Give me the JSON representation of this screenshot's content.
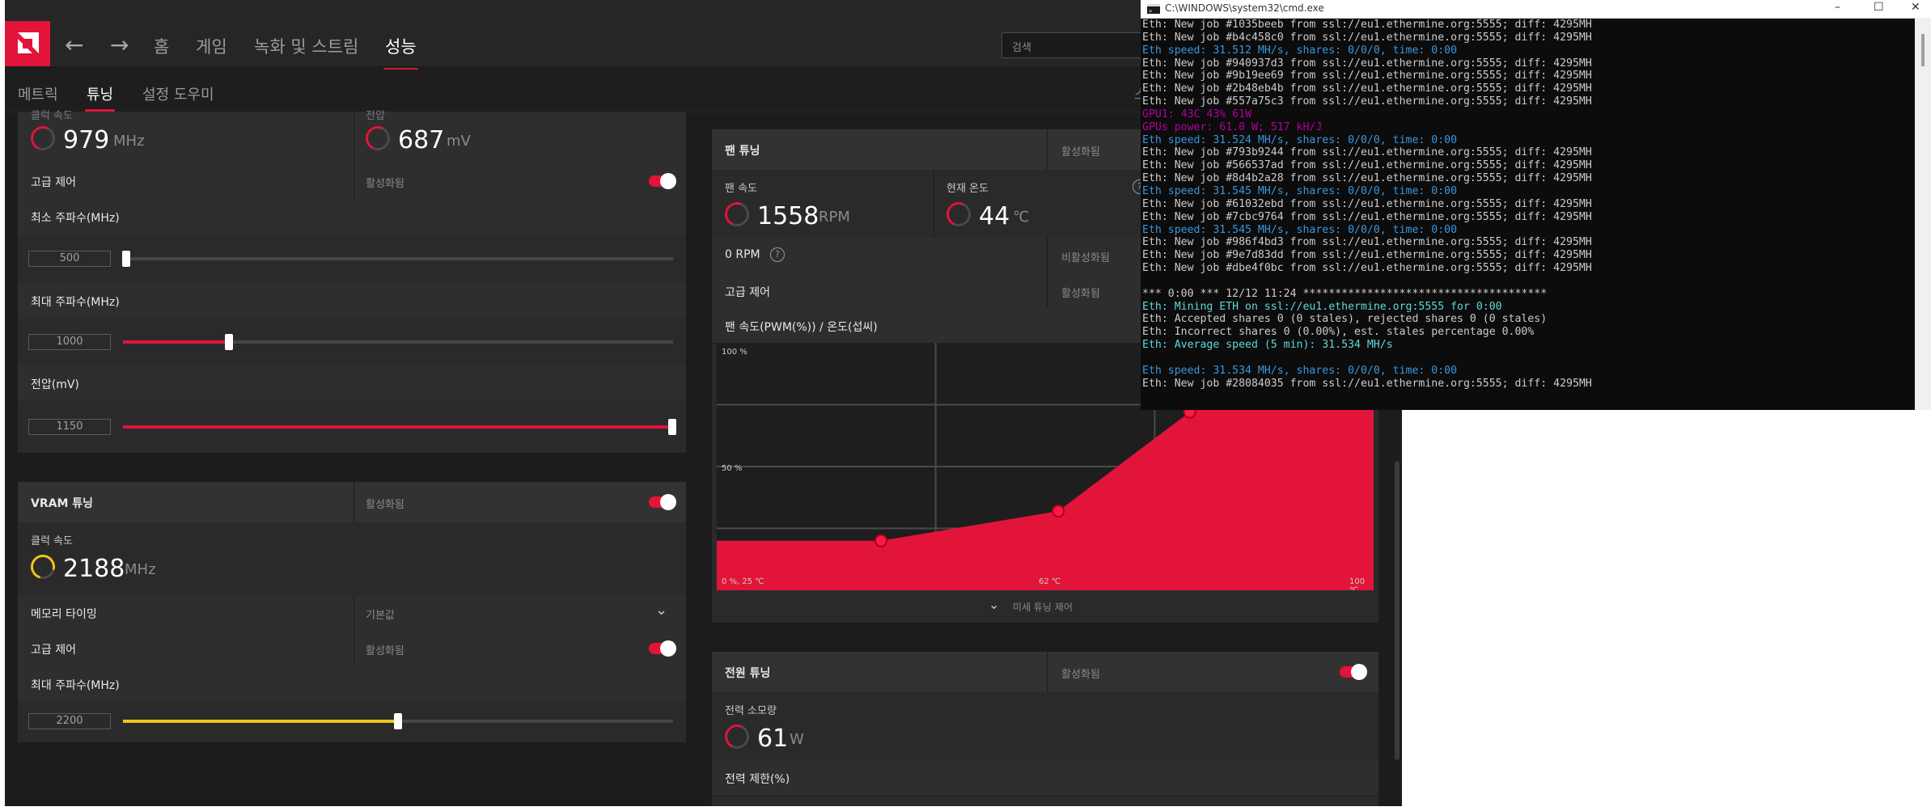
{
  "header": {
    "nav": [
      "홈",
      "게임",
      "녹화 및 스트림",
      "성능"
    ],
    "active_nav": "성능",
    "search_placeholder": "검색"
  },
  "subnav": {
    "items": [
      "메트릭",
      "튜닝",
      "설정 도우미"
    ],
    "active": "튜닝",
    "cut_text": "스"
  },
  "gpu_tuning": {
    "clock_label_cut": "클럭 속도",
    "voltage_label_cut": "전압",
    "clock_value": "979",
    "clock_unit": "MHz",
    "voltage_value": "687",
    "voltage_unit": "mV",
    "advanced_label": "고급 제어",
    "advanced_status": "활성화됨",
    "min_freq_label": "최소 주파수(MHz)",
    "min_freq_value": "500",
    "max_freq_label": "최대 주파수(MHz)",
    "max_freq_value": "1000",
    "voltage_mv_label": "전압(mV)",
    "voltage_mv_value": "1150"
  },
  "vram_tuning": {
    "title": "VRAM 튜닝",
    "status": "활성화됨",
    "clock_label": "클럭 속도",
    "clock_value": "2188",
    "clock_unit": "MHz",
    "memory_timing_label": "메모리 타이밍",
    "memory_timing_value": "기본값",
    "advanced_label": "고급 제어",
    "advanced_status": "활성화됨",
    "max_freq_label": "최대 주파수(MHz)",
    "max_freq_value": "2200"
  },
  "fan_tuning": {
    "title": "팬 튜닝",
    "status": "활성화됨",
    "fan_speed_label": "팬 속도",
    "fan_speed_value": "1558",
    "fan_speed_unit": "RPM",
    "temp_label": "현재 온도",
    "temp_value": "44",
    "temp_unit": "℃",
    "zero_rpm_label": "0 RPM",
    "zero_rpm_status": "비활성화됨",
    "advanced_label": "고급 제어",
    "advanced_status": "활성화됨",
    "curve_label": "팬 속도(PWM(%)) / 온도(섭씨)",
    "fine_tune_label": "미세 튜닝 제어"
  },
  "chart_data": {
    "type": "area",
    "xlabel": "",
    "ylabel": "",
    "y_tick_labels": [
      "100 %",
      "50 %"
    ],
    "x_tick_labels": [
      "0 %, 25 ℃",
      "62 ℃",
      "100 ℃"
    ],
    "points": [
      [
        25,
        20
      ],
      [
        52,
        32
      ],
      [
        72,
        72
      ],
      [
        83,
        100
      ],
      [
        100,
        100
      ]
    ],
    "xlim": [
      0,
      100
    ],
    "ylim": [
      0,
      100
    ],
    "fill_color": "#e2143a"
  },
  "power_tuning": {
    "title": "전원 튜닝",
    "status": "활성화됨",
    "consumption_label": "전력 소모량",
    "consumption_value": "61",
    "consumption_unit": "W",
    "limit_label": "전력 제한(%)"
  },
  "cmd": {
    "title": "C:\\WINDOWS\\system32\\cmd.exe",
    "lines": [
      {
        "c": "w",
        "t": "Eth: New job #1035beeb from ssl://eu1.ethermine.org:5555; diff: 4295MH"
      },
      {
        "c": "w",
        "t": "Eth: New job #b4c458c0 from ssl://eu1.ethermine.org:5555; diff: 4295MH"
      },
      {
        "c": "c",
        "t": "Eth speed: 31.512 MH/s, shares: 0/0/0, time: 0:00"
      },
      {
        "c": "w",
        "t": "Eth: New job #940937d3 from ssl://eu1.ethermine.org:5555; diff: 4295MH"
      },
      {
        "c": "w",
        "t": "Eth: New job #9b19ee69 from ssl://eu1.ethermine.org:5555; diff: 4295MH"
      },
      {
        "c": "w",
        "t": "Eth: New job #2b48eb4b from ssl://eu1.ethermine.org:5555; diff: 4295MH"
      },
      {
        "c": "w",
        "t": "Eth: New job #557a75c3 from ssl://eu1.ethermine.org:5555; diff: 4295MH"
      },
      {
        "c": "m",
        "t": "GPU1: 43C 43% 61W"
      },
      {
        "c": "m",
        "t": "GPUs power: 61.0 W; 517 kH/J"
      },
      {
        "c": "c",
        "t": "Eth speed: 31.524 MH/s, shares: 0/0/0, time: 0:00"
      },
      {
        "c": "w",
        "t": "Eth: New job #793b9244 from ssl://eu1.ethermine.org:5555; diff: 4295MH"
      },
      {
        "c": "w",
        "t": "Eth: New job #566537ad from ssl://eu1.ethermine.org:5555; diff: 4295MH"
      },
      {
        "c": "w",
        "t": "Eth: New job #8d4b2a28 from ssl://eu1.ethermine.org:5555; diff: 4295MH"
      },
      {
        "c": "c",
        "t": "Eth speed: 31.545 MH/s, shares: 0/0/0, time: 0:00"
      },
      {
        "c": "w",
        "t": "Eth: New job #61032ebd from ssl://eu1.ethermine.org:5555; diff: 4295MH"
      },
      {
        "c": "w",
        "t": "Eth: New job #7cbc9764 from ssl://eu1.ethermine.org:5555; diff: 4295MH"
      },
      {
        "c": "c",
        "t": "Eth speed: 31.545 MH/s, shares: 0/0/0, time: 0:00"
      },
      {
        "c": "w",
        "t": "Eth: New job #986f4bd3 from ssl://eu1.ethermine.org:5555; diff: 4295MH"
      },
      {
        "c": "w",
        "t": "Eth: New job #9e7d83dd from ssl://eu1.ethermine.org:5555; diff: 4295MH"
      },
      {
        "c": "w",
        "t": "Eth: New job #dbe4f0bc from ssl://eu1.ethermine.org:5555; diff: 4295MH"
      },
      {
        "c": "w",
        "t": ""
      },
      {
        "c": "w",
        "t": "*** 0:00 *** 12/12 11:24 **************************************"
      },
      {
        "c": "t",
        "t": "Eth: Mining ETH on ssl://eu1.ethermine.org:5555 for 0:00"
      },
      {
        "c": "w",
        "t": "Eth: Accepted shares 0 (0 stales), rejected shares 0 (0 stales)"
      },
      {
        "c": "w",
        "t": "Eth: Incorrect shares 0 (0.00%), est. stales percentage 0.00%"
      },
      {
        "c": "t",
        "t": "Eth: Average speed (5 min): 31.534 MH/s"
      },
      {
        "c": "w",
        "t": ""
      },
      {
        "c": "c",
        "t": "Eth speed: 31.534 MH/s, shares: 0/0/0, time: 0:00"
      },
      {
        "c": "w",
        "t": "Eth: New job #28084035 from ssl://eu1.ethermine.org:5555; diff: 4295MH"
      }
    ]
  },
  "colors": {
    "accent_red": "#e2143a",
    "accent_yellow": "#f2c41a",
    "cmd_cyan": "#3a96dd",
    "cmd_magenta": "#b4009e"
  },
  "sliders": {
    "min_freq_fraction": 0.0,
    "max_freq_fraction": 0.19,
    "voltage_fraction": 1.0,
    "vram_max_fraction": 0.5
  }
}
